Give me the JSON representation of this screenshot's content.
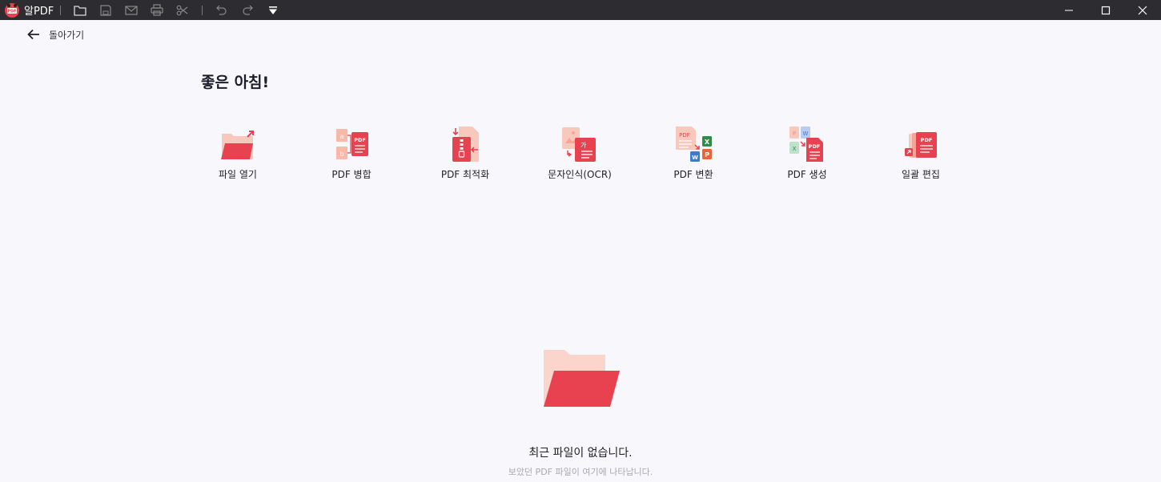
{
  "app": {
    "name": "알PDF",
    "logo_text": "PDF"
  },
  "toolbar": {
    "icons": [
      "folder-icon",
      "save-icon",
      "mail-icon",
      "print-icon",
      "scissors-icon",
      "undo-icon",
      "redo-icon",
      "more-dropdown-icon"
    ]
  },
  "nav": {
    "back_label": "돌아가기"
  },
  "greeting": "좋은 아침!",
  "tools": [
    {
      "label": "파일 열기"
    },
    {
      "label": "PDF 병합"
    },
    {
      "label": "PDF 최적화"
    },
    {
      "label": "문자인식(OCR)"
    },
    {
      "label": "PDF 변환"
    },
    {
      "label": "PDF 생성"
    },
    {
      "label": "일괄 편집"
    }
  ],
  "icon_text": {
    "pdf": "PDF",
    "a": "a",
    "b": "b",
    "ga": "가",
    "x": "X",
    "w": "W",
    "p": "P"
  },
  "empty_state": {
    "title": "최근 파일이 없습니다.",
    "subtitle": "보았던 PDF 파일이 여기에 나타납니다."
  },
  "colors": {
    "titlebar": "#2d2d31",
    "accent_red": "#e8414f",
    "light_pink": "#f9c1b8",
    "background": "#f8f8fc"
  }
}
